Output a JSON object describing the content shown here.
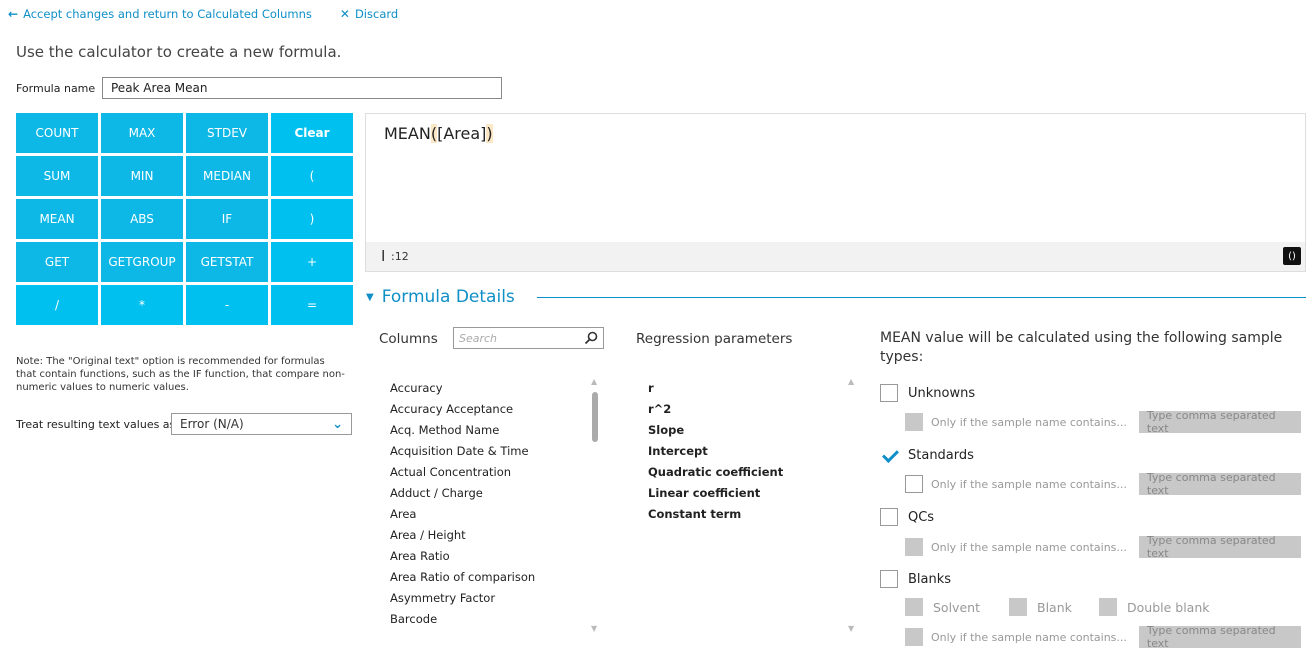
{
  "toolbar": {
    "accept_label": "Accept changes and return to Calculated Columns",
    "discard_label": "Discard"
  },
  "header": {
    "instruction": "Use the calculator to create a new formula.",
    "formula_name_label": "Formula name",
    "formula_name_value": "Peak Area Mean"
  },
  "calculator": {
    "buttons": [
      "COUNT",
      "MAX",
      "STDEV",
      "Clear",
      "SUM",
      "MIN",
      "MEDIAN",
      "(",
      "MEAN",
      "ABS",
      "IF",
      ")",
      "GET",
      "GETGROUP",
      "GETSTAT",
      "+",
      "/",
      "*",
      "-",
      "="
    ]
  },
  "note": {
    "text": "Note: The \"Original text\" option is recommended for formulas that contain functions, such as the IF function, that compare non-numeric values to numeric values.",
    "treat_label": "Treat resulting text values as",
    "treat_value": "Error (N/A)"
  },
  "editor": {
    "func": "MEAN",
    "open": "(",
    "arg": "[Area]",
    "close": ")",
    "cursor_pos": ":12",
    "paren_button": "()"
  },
  "details": {
    "title": "Formula Details",
    "columns_label": "Columns",
    "search_placeholder": "Search",
    "columns": [
      "Accuracy",
      "Accuracy Acceptance",
      "Acq. Method Name",
      "Acquisition Date & Time",
      "Actual Concentration",
      "Adduct / Charge",
      "Area",
      "Area / Height",
      "Area Ratio",
      "Area Ratio of comparison",
      "Asymmetry Factor",
      "Barcode"
    ],
    "regression_label": "Regression parameters",
    "regression": [
      "r",
      "r^2",
      "Slope",
      "Intercept",
      "Quadratic coefficient",
      "Linear coefficient",
      "Constant term"
    ],
    "sample_header": "MEAN value will be calculated using the following sample types:",
    "only_if": "Only if the sample name contains...",
    "comma_placeholder": "Type comma separated text",
    "types": {
      "unknowns": "Unknowns",
      "standards": "Standards",
      "qcs": "QCs",
      "blanks": "Blanks"
    },
    "blank_subtypes": {
      "solvent": "Solvent",
      "blank": "Blank",
      "double_blank": "Double blank"
    }
  },
  "colors": {
    "accent": "#0f8fc7",
    "button": "#0db8e6"
  }
}
